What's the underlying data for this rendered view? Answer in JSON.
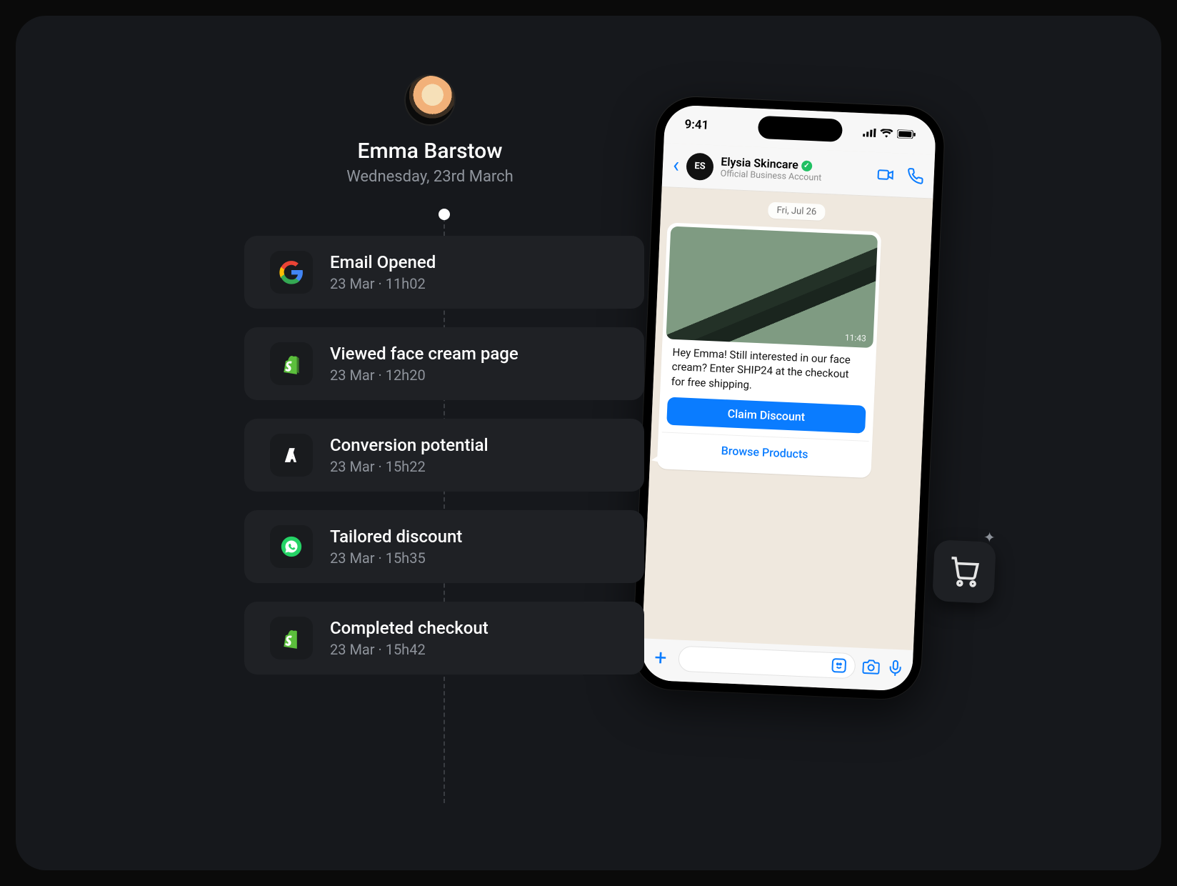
{
  "customer": {
    "name": "Emma Barstow",
    "date_line": "Wednesday, 23rd March"
  },
  "events": [
    {
      "icon": "google",
      "title": "Email Opened",
      "meta": "23 Mar · 11h02"
    },
    {
      "icon": "shopify",
      "title": "Viewed face cream page",
      "meta": "23 Mar · 12h20"
    },
    {
      "icon": "anthropic",
      "title": "Conversion potential",
      "meta": "23 Mar · 15h22"
    },
    {
      "icon": "whatsapp",
      "title": "Tailored discount",
      "meta": "23 Mar · 15h35"
    },
    {
      "icon": "shopify",
      "title": "Completed checkout",
      "meta": "23 Mar · 15h42"
    }
  ],
  "phone": {
    "status_time": "9:41",
    "business_name": "Elysia Skincare",
    "business_sub": "Official Business Account",
    "business_initials": "ES",
    "date_chip": "Fri, Jul 26",
    "image_timestamp": "11:43",
    "message_text": "Hey Emma! Still interested in our face cream? Enter SHIP24 at the checkout for free shipping.",
    "primary_button": "Claim Discount",
    "secondary_button": "Browse Products"
  }
}
